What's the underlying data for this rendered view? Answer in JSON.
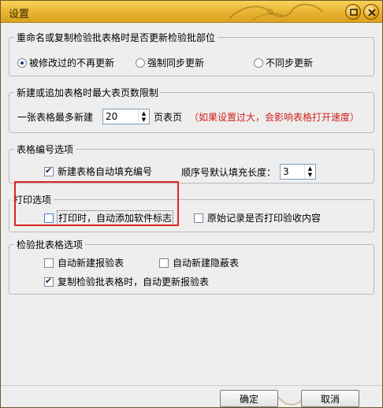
{
  "window": {
    "title": "设置",
    "accent": "#e8b332"
  },
  "group_rename": {
    "title": "重命名或复制检验批表格时是否更新检验批部位",
    "options": [
      {
        "label": "被修改过的不再更新",
        "selected": true
      },
      {
        "label": "强制同步更新",
        "selected": false
      },
      {
        "label": "不同步更新",
        "selected": false
      }
    ]
  },
  "group_pages": {
    "title": "新建或追加表格时最大表页数限制",
    "label_before": "一张表格最多新建",
    "value": "20",
    "label_after": "页表页",
    "warning": "（如果设置过大，会影响表格打开速度）"
  },
  "group_numbering": {
    "title": "表格编号选项",
    "auto_fill_label": "新建表格自动填充编号",
    "auto_fill_checked": true,
    "seq_label": "顺序号默认填充长度：",
    "seq_value": "3"
  },
  "group_print": {
    "title": "打印选项",
    "auto_sign_label": "打印时，自动添加软件标志",
    "auto_sign_checked": false,
    "original_label": "原始记录是否打印验收内容",
    "original_checked": false
  },
  "group_inspection": {
    "title": "检验批表格选项",
    "auto_report_label": "自动新建报验表",
    "auto_report_checked": false,
    "auto_hidden_label": "自动新建隐蔽表",
    "auto_hidden_checked": false,
    "copy_update_label": "复制检验批表格时，自动更新报验表",
    "copy_update_checked": true
  },
  "buttons": {
    "ok": "确定",
    "cancel": "取消"
  },
  "colors": {
    "warning": "#d21e1e",
    "highlight_box": "#e02222"
  }
}
